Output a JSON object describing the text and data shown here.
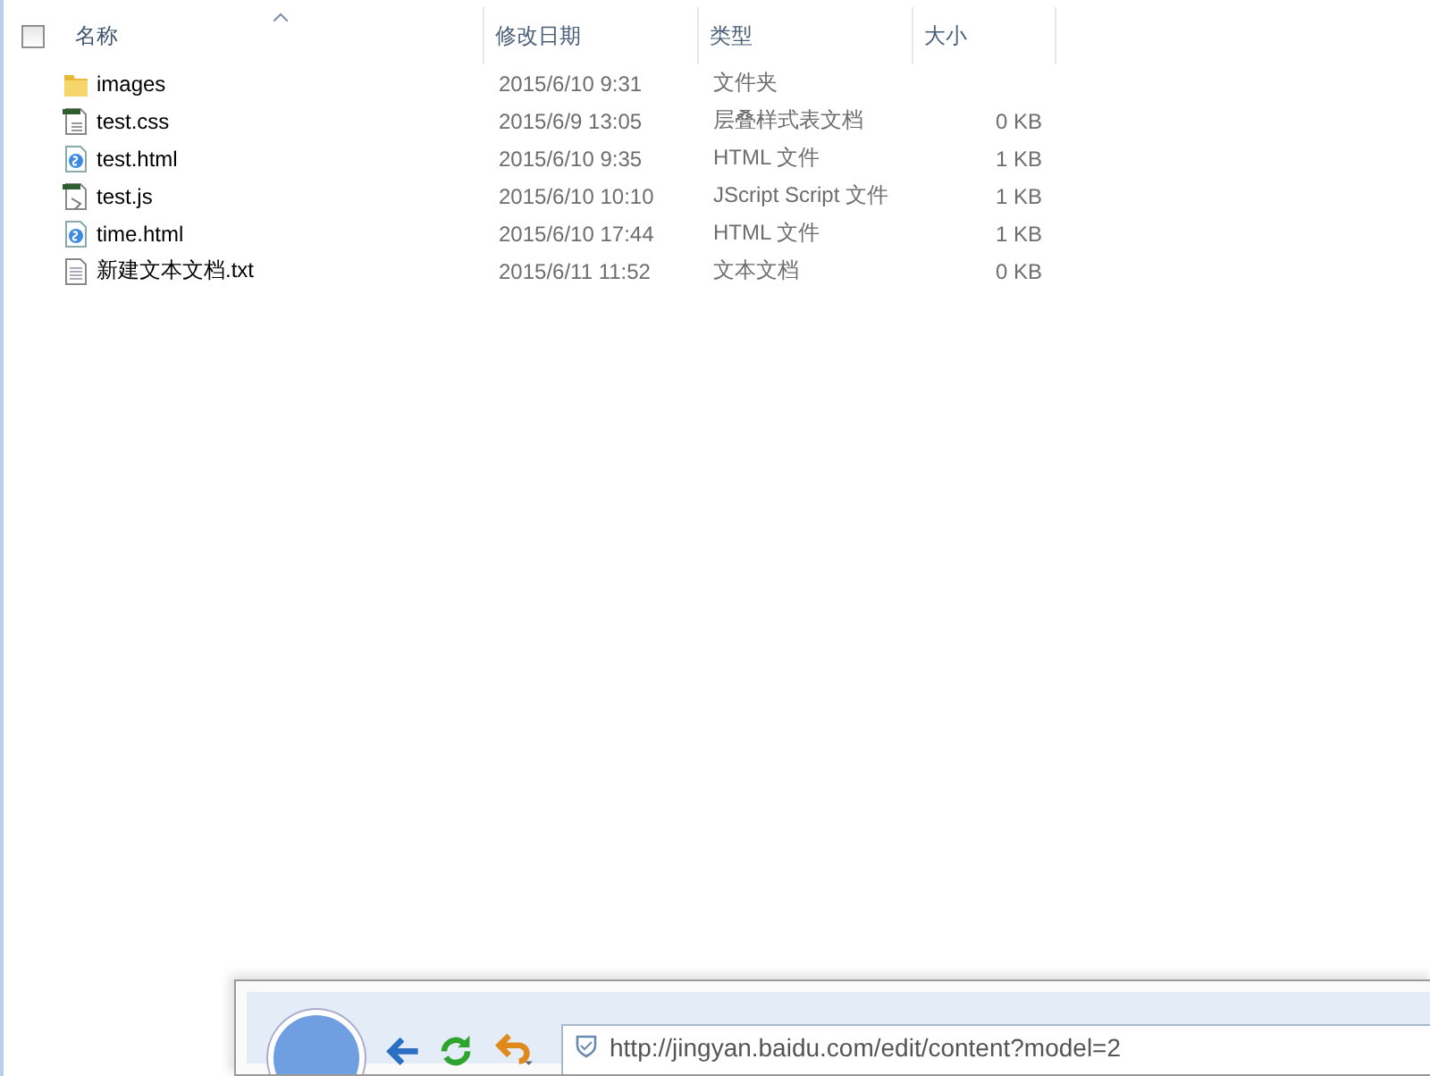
{
  "select_all": {
    "checked": false
  },
  "columns": [
    {
      "label": "名称",
      "sorted": true
    },
    {
      "label": "修改日期",
      "sorted": false
    },
    {
      "label": "类型",
      "sorted": false
    },
    {
      "label": "大小",
      "sorted": false
    }
  ],
  "files": [
    {
      "kind": "folder",
      "name": "images",
      "modified": "2015/6/10 9:31",
      "type": "文件夹"
    },
    {
      "kind": "css",
      "name": "test.css",
      "modified": "2015/6/9 13:05",
      "type": "层叠样式表文档",
      "size": "0 KB"
    },
    {
      "kind": "html",
      "name": "test.html",
      "modified": "2015/6/10 9:35",
      "type": "HTML 文件",
      "size": "1 KB"
    },
    {
      "kind": "script",
      "name": "test.js",
      "modified": "2015/6/10 10:10",
      "type": "JScript Script 文件",
      "size": "1 KB"
    },
    {
      "kind": "html",
      "name": "time.html",
      "modified": "2015/6/10 17:44",
      "type": "HTML 文件",
      "size": "1 KB"
    },
    {
      "kind": "text",
      "name": "新建文本文档.txt",
      "modified": "2015/6/11 11:52",
      "type": "文本文档",
      "size": "0 KB"
    }
  ],
  "browser": {
    "url": "http://jingyan.baidu.com/edit/content?model=2"
  }
}
